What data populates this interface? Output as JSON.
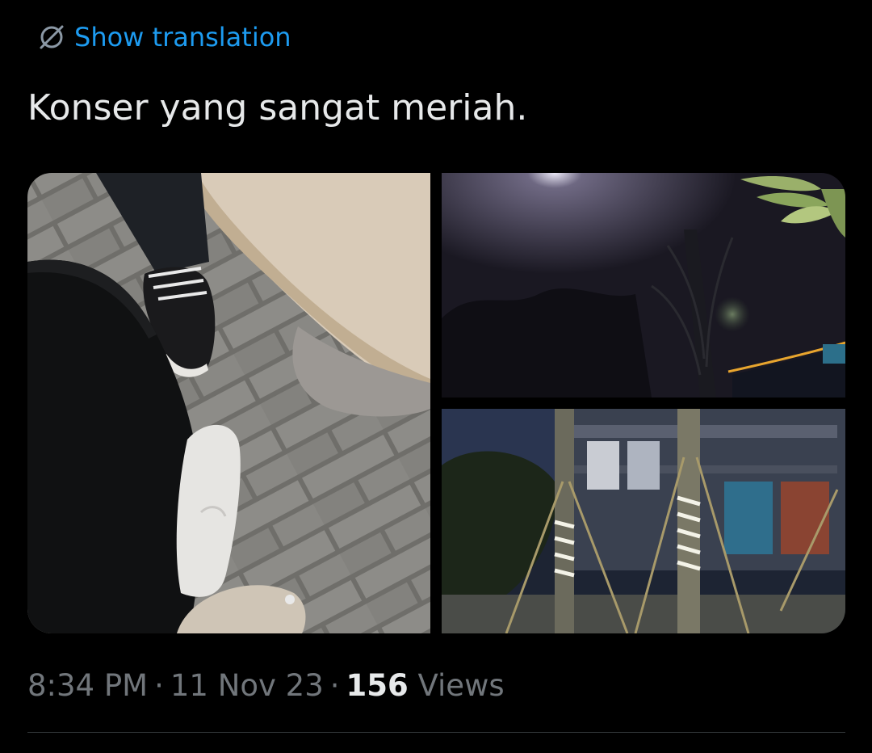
{
  "translate": {
    "label": "Show translation",
    "icon": "globe-slash-icon",
    "color": "#1d9bf0"
  },
  "tweet": {
    "text": "Konser yang sangat meriah."
  },
  "media": {
    "photos": [
      {
        "subject": "feet-on-paving-stones-photo"
      },
      {
        "subject": "night-sky-palm-photo"
      },
      {
        "subject": "lit-trees-plaza-photo"
      }
    ]
  },
  "meta": {
    "time": "8:34 PM",
    "separator": "·",
    "date": "11 Nov 23",
    "views_count": "156",
    "views_label": "Views"
  },
  "colors": {
    "background": "#000000",
    "text": "#e7e9ea",
    "muted": "#71767b",
    "accent": "#1d9bf0",
    "divider": "#2f3336"
  }
}
